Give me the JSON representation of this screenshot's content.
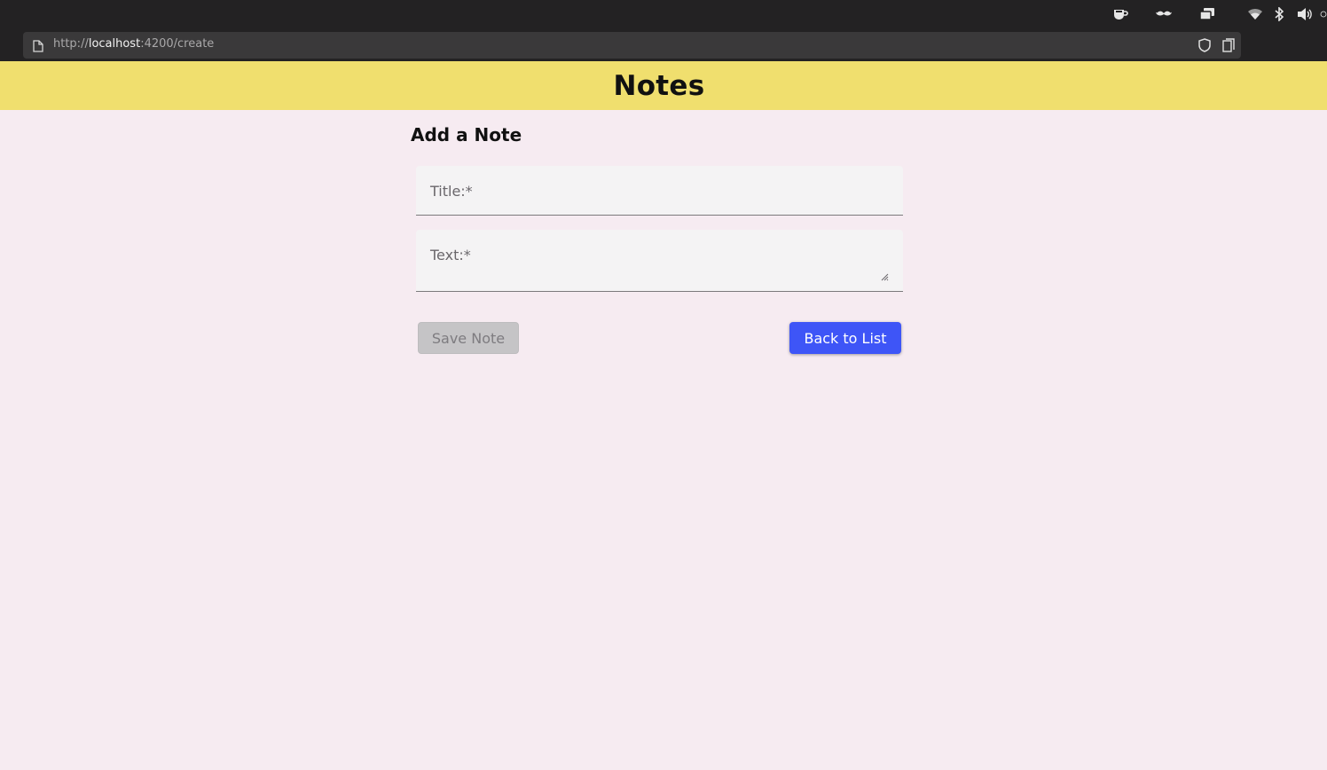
{
  "browser": {
    "url_scheme": "http://",
    "url_host": "localhost",
    "url_rest": ":4200/create",
    "tray_icons": [
      "coffee-cup-icon",
      "mustache-icon",
      "window-switcher-icon",
      "wifi-icon",
      "bluetooth-icon",
      "volume-icon",
      "power-icon"
    ],
    "url_icons": [
      "page-icon",
      "shield-icon",
      "bookmark-icon"
    ]
  },
  "header": {
    "title": "Notes",
    "background_color": "#f0df6e"
  },
  "form": {
    "heading": "Add a Note",
    "title_field": {
      "label": "Title:*",
      "value": ""
    },
    "text_field": {
      "label": "Text:*",
      "value": ""
    },
    "save_button": {
      "label": "Save Note",
      "state": "disabled"
    },
    "back_button": {
      "label": "Back to List",
      "color": "#3e55f7"
    }
  },
  "page_background": "#f6ebf1"
}
